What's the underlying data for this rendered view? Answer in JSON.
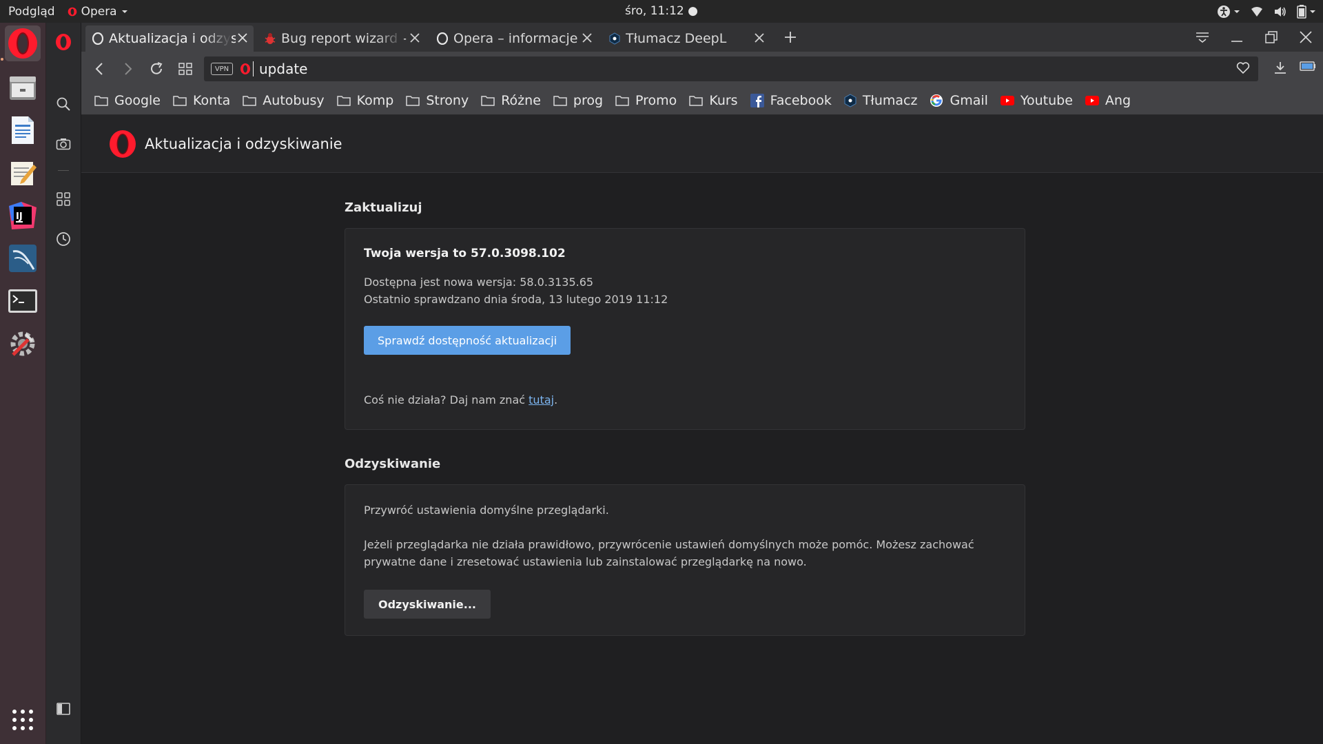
{
  "top_panel": {
    "app_menu": "Podgląd",
    "active_app": "Opera",
    "clock": "śro, 11:12"
  },
  "launcher": {
    "items": [
      "opera",
      "files",
      "writer",
      "text-editor",
      "intellij",
      "mysql-workbench",
      "terminal",
      "system-tools"
    ]
  },
  "tabs": [
    {
      "title": "Aktualizacja i odzyskiwanie",
      "active": true
    },
    {
      "title": "Bug report wizard - Opera",
      "active": false
    },
    {
      "title": "Opera – informacje",
      "active": false
    },
    {
      "title": "Tłumacz DeepL",
      "active": false
    }
  ],
  "address_bar": {
    "vpn_label": "VPN",
    "url": "update"
  },
  "bookmarks": [
    {
      "label": "Google",
      "icon": "folder-icon"
    },
    {
      "label": "Konta",
      "icon": "folder-icon"
    },
    {
      "label": "Autobusy",
      "icon": "folder-icon"
    },
    {
      "label": "Komp",
      "icon": "folder-icon"
    },
    {
      "label": "Strony",
      "icon": "folder-icon"
    },
    {
      "label": "Różne",
      "icon": "folder-icon"
    },
    {
      "label": "prog",
      "icon": "folder-icon"
    },
    {
      "label": "Promo",
      "icon": "folder-icon"
    },
    {
      "label": "Kurs",
      "icon": "folder-icon"
    },
    {
      "label": "Facebook",
      "icon": "facebook-icon"
    },
    {
      "label": "Tłumacz",
      "icon": "deepl-icon"
    },
    {
      "label": "Gmail",
      "icon": "google-icon"
    },
    {
      "label": "Youtube",
      "icon": "youtube-icon"
    },
    {
      "label": "Ang",
      "icon": "youtube-icon"
    }
  ],
  "page": {
    "header_title": "Aktualizacja i odzyskiwanie",
    "update_section": {
      "title": "Zaktualizuj",
      "version_text": "Twoja wersja to 57.0.3098.102",
      "new_version_text": "Dostępna jest nowa wersja: 58.0.3135.65",
      "last_checked_text": "Ostatnio sprawdzano dnia środa, 13 lutego 2019 11:12",
      "check_button": "Sprawdź dostępność aktualizacji",
      "problem_prefix": "Coś nie działa? Daj nam znać ",
      "problem_link": "tutaj",
      "problem_suffix": "."
    },
    "recovery_section": {
      "title": "Odzyskiwanie",
      "restore_text": "Przywróć ustawienia domyślne przeglądarki.",
      "description_line1": "Jeżeli przeglądarka nie działa prawidłowo, przywrócenie ustawień domyślnych może pomóc. Możesz zachować",
      "description_line2": "prywatne dane i zresetować ustawienia lub zainstalować przeglądarkę na nowo.",
      "recovery_button": "Odzyskiwanie..."
    }
  },
  "colors": {
    "opera_red": "#ff1b2d",
    "primary_button": "#5b9ee6",
    "link": "#7cb5f0",
    "launcher_bg": "#3e3036"
  }
}
